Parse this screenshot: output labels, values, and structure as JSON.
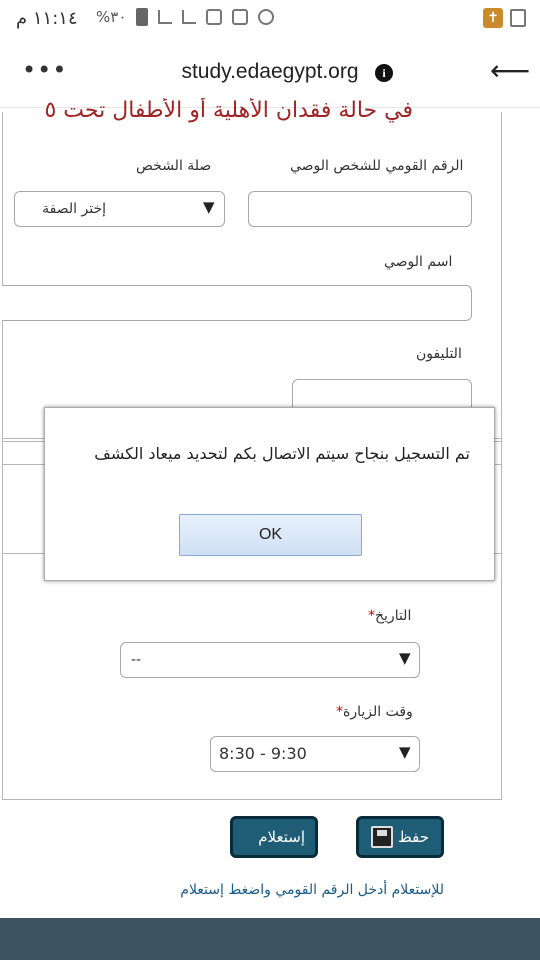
{
  "status_bar": {
    "time": "١١:١٤ م",
    "battery": "%٣٠"
  },
  "browser": {
    "url": "study.edaegypt.org",
    "menu_icon": "more-dots-icon",
    "info_icon": "info-icon",
    "back_icon": "back-arrow-icon"
  },
  "form": {
    "legend": "في حالة فقدان الأهلية أو الأطفال تحت ٥",
    "guardian_id_label": "الرقم القومي للشخص الوصي",
    "relation_label": "صلة الشخص",
    "relation_selected": "إختر الصفة",
    "guardian_name_label": "اسم الوصي",
    "phone_label": "التليفون",
    "date_label": "التاريخ",
    "date_selected": "--",
    "visit_time_label": "وقت الزيارة",
    "visit_time_selected": "8:30 - 9:30",
    "required_mark": "*",
    "save_button": "حفظ",
    "query_button": "إستعلام",
    "hint": "للإستعلام أدخل الرقم القومي واضغط إستعلام"
  },
  "dialog": {
    "message": "تم التسجيل بنجاح سيتم الاتصال بكم لتحديد ميعاد الكشف",
    "ok": "OK"
  }
}
